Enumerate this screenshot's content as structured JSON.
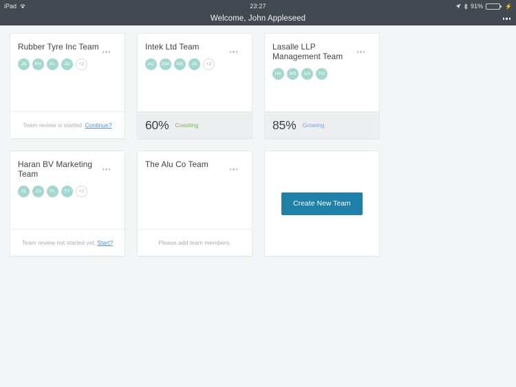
{
  "statusbar": {
    "device": "iPad",
    "wifi_icon": "wifi-icon",
    "time": "23:27",
    "location_icon": "location-arrow-icon",
    "bluetooth_icon": "bluetooth-icon",
    "battery_percent": "91%",
    "battery_level": 91,
    "battery_icon": "battery-icon",
    "charging_icon": "charging-bolt-icon"
  },
  "navbar": {
    "title": "Welcome, John Appleseed",
    "more_icon": "overflow-menu-icon"
  },
  "colors": {
    "navbar_bg": "#434951",
    "page_bg": "#f4f5f6",
    "card_bg": "#ffffff",
    "avatar_bg": "#a5d7d1",
    "accent_button": "#1f80a9",
    "link": "#4a90d9",
    "coasting": "#7cae56",
    "growing": "#6fa8dc",
    "score_footer_bg": "#eceef0"
  },
  "cards": [
    {
      "title": "Rubber Tyre Inc Team",
      "menu_icon": "overflow-menu-icon",
      "avatars": [
        "JB",
        "RH",
        "PL",
        "JD"
      ],
      "overflow_avatar": "+2",
      "footer_type": "plain",
      "footer_text": "Team review is started.",
      "footer_link": "Continue?"
    },
    {
      "title": "Intek Ltd Team",
      "menu_icon": "overflow-menu-icon",
      "avatars": [
        "AC",
        "DM",
        "NR",
        "JS"
      ],
      "overflow_avatar": "+2",
      "footer_type": "score",
      "score": "60%",
      "status": "Coasting",
      "status_color": "#7cae56"
    },
    {
      "title": "Lasalle LLP Management Team",
      "menu_icon": "overflow-menu-icon",
      "avatars": [
        "HK",
        "NS",
        "AA",
        "TG"
      ],
      "overflow_avatar": "",
      "footer_type": "score",
      "score": "85%",
      "status": "Growing",
      "status_color": "#6fa8dc"
    },
    {
      "title": "Haran BV Marketing Team",
      "menu_icon": "overflow-menu-icon",
      "avatars": [
        "IS",
        "JD",
        "PL",
        "TY"
      ],
      "overflow_avatar": "+1",
      "footer_type": "plain",
      "footer_text": "Team review not started yet.",
      "footer_link": "Start?"
    },
    {
      "title": "The Alu Co Team",
      "menu_icon": "overflow-menu-icon",
      "avatars": [],
      "overflow_avatar": "",
      "footer_type": "plain",
      "footer_text": "Please add team members.",
      "footer_link": ""
    }
  ],
  "create_card": {
    "button_label": "Create New Team"
  }
}
